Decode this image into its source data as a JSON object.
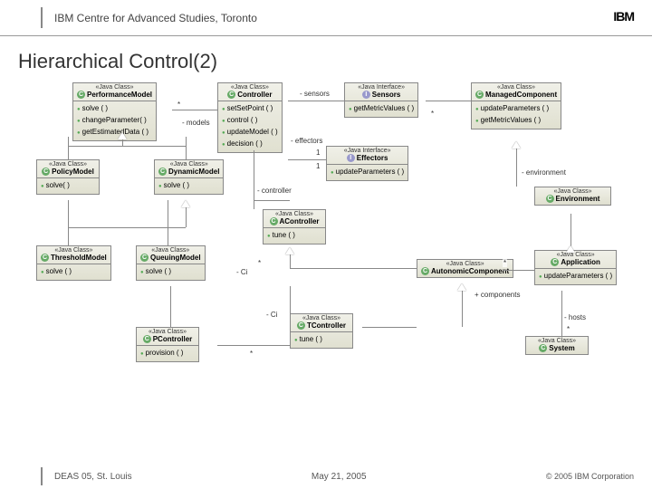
{
  "header": {
    "title": "IBM Centre for Advanced Studies, Toronto",
    "logo": "IBM"
  },
  "slide": {
    "title": "Hierarchical Control(2)"
  },
  "classes": {
    "perfModel": {
      "stereo": "«Java Class»",
      "name": "PerformanceModel",
      "ops": [
        "solve ( )",
        "changeParameter( )",
        "getEstimatedData ( )"
      ]
    },
    "controller": {
      "stereo": "«Java Class»",
      "name": "Controller",
      "ops": [
        "setSetPoint ( )",
        "control ( )",
        "updateModel ( )",
        "decision ( )"
      ]
    },
    "sensors": {
      "stereo": "«Java Interface»",
      "name": "Sensors",
      "ops": [
        "getMetricValues ( )"
      ]
    },
    "managedComp": {
      "stereo": "«Java Class»",
      "name": "ManagedComponent",
      "ops": [
        "updateParameters ( )",
        "getMetricValues ( )"
      ]
    },
    "policyModel": {
      "stereo": "«Java Class»",
      "name": "PolicyModel",
      "ops": [
        "solve( )"
      ]
    },
    "dynamicModel": {
      "stereo": "«Java Class»",
      "name": "DynamicModel",
      "ops": [
        "solve ( )"
      ]
    },
    "effectors": {
      "stereo": "«Java Interface»",
      "name": "Effectors",
      "ops": [
        "updateParameters ( )"
      ]
    },
    "environment": {
      "stereo": "«Java Class»",
      "name": "Environment",
      "ops": []
    },
    "aController": {
      "stereo": "«Java Class»",
      "name": "AController",
      "ops": [
        "tune ( )"
      ]
    },
    "thresholdModel": {
      "stereo": "«Java Class»",
      "name": "ThresholdModel",
      "ops": [
        "solve ( )"
      ]
    },
    "queuingModel": {
      "stereo": "«Java Class»",
      "name": "QueuingModel",
      "ops": [
        "solve ( )"
      ]
    },
    "autonomicComp": {
      "stereo": "«Java Class»",
      "name": "AutonomicComponent",
      "ops": []
    },
    "application": {
      "stereo": "«Java Class»",
      "name": "Application",
      "ops": [
        "updateParameters ( )"
      ]
    },
    "pController": {
      "stereo": "«Java Class»",
      "name": "PController",
      "ops": [
        "provision ( )"
      ]
    },
    "tController": {
      "stereo": "«Java Class»",
      "name": "TController",
      "ops": [
        "tune ( )"
      ]
    },
    "system": {
      "stereo": "«Java Class»",
      "name": "System",
      "ops": []
    }
  },
  "labels": {
    "sensors": "- sensors",
    "models": "- models",
    "effectors": "- effectors",
    "controller": "- controller",
    "environment": "- environment",
    "components": "+ components",
    "hosts": "- hosts",
    "one_a": "1",
    "one_b": "1",
    "star_a": "*",
    "star_b": "*",
    "star_c": "*",
    "star_d": "*",
    "star_e": "*",
    "star_f": "*",
    "ci_a": "- Ci",
    "ci_b": "- Ci"
  },
  "footer": {
    "left": "DEAS 05, St. Louis",
    "center": "May 21, 2005",
    "right": "© 2005 IBM Corporation"
  }
}
